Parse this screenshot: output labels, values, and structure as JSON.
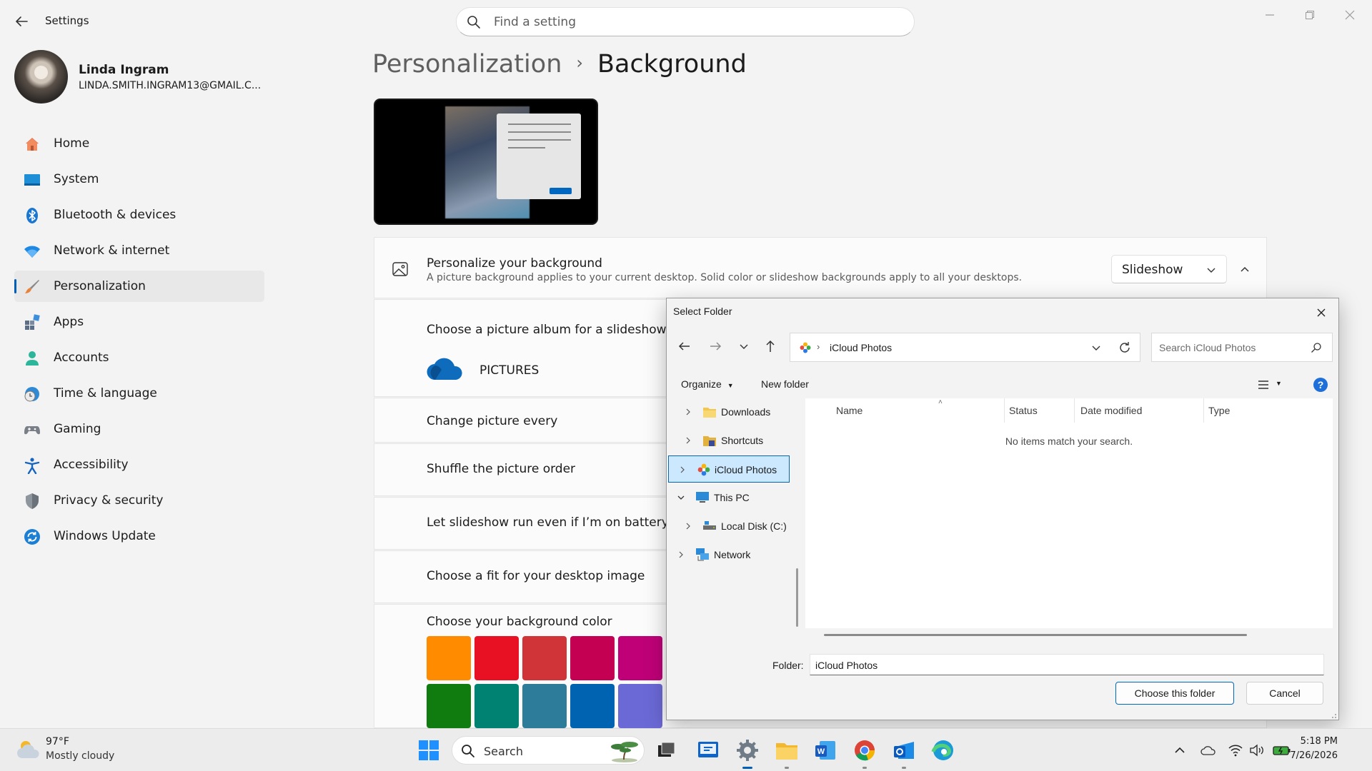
{
  "window": {
    "title": "Settings",
    "search_placeholder": "Find a setting"
  },
  "profile": {
    "name": "Linda Ingram",
    "email": "LINDA.SMITH.INGRAM13@GMAIL.C..."
  },
  "sidebar": {
    "items": [
      {
        "label": "Home",
        "icon": "home-icon"
      },
      {
        "label": "System",
        "icon": "system-icon"
      },
      {
        "label": "Bluetooth & devices",
        "icon": "bluetooth-icon"
      },
      {
        "label": "Network & internet",
        "icon": "wifi-icon"
      },
      {
        "label": "Personalization",
        "icon": "brush-icon",
        "active": true
      },
      {
        "label": "Apps",
        "icon": "apps-icon"
      },
      {
        "label": "Accounts",
        "icon": "person-icon"
      },
      {
        "label": "Time & language",
        "icon": "clock-globe-icon"
      },
      {
        "label": "Gaming",
        "icon": "gamepad-icon"
      },
      {
        "label": "Accessibility",
        "icon": "accessibility-icon"
      },
      {
        "label": "Privacy & security",
        "icon": "shield-icon"
      },
      {
        "label": "Windows Update",
        "icon": "update-icon"
      }
    ]
  },
  "breadcrumb": {
    "parent": "Personalization",
    "separator": "›",
    "current": "Background"
  },
  "background": {
    "title": "Personalize your background",
    "description": "A picture background applies to your current desktop. Solid color or slideshow backgrounds apply to all your desktops.",
    "mode": "Slideshow",
    "album_title": "Choose a picture album for a slideshow",
    "album_name": "PICTURES",
    "change_every": "Change picture every",
    "shuffle": "Shuffle the picture order",
    "battery": "Let slideshow run even if I’m on battery pow",
    "fit": "Choose a fit for your desktop image",
    "color_title": "Choose your background color",
    "swatches_row1": [
      "#ff8c00",
      "#e81123",
      "#d13438",
      "#c30052",
      "#bf0077"
    ],
    "swatches_row2": [
      "#107c10",
      "#008272",
      "#2d7d9a",
      "#0063b1",
      "#6b69d6"
    ]
  },
  "dialog": {
    "title": "Select Folder",
    "address": "iCloud Photos",
    "search_placeholder": "Search iCloud Photos",
    "organize": "Organize",
    "new_folder": "New folder",
    "tree": [
      {
        "label": "Downloads",
        "icon": "downloads-folder-icon",
        "indent": 2
      },
      {
        "label": "Shortcuts",
        "icon": "shortcuts-folder-icon",
        "indent": 2
      },
      {
        "label": "iCloud Photos",
        "icon": "icloud-photos-icon",
        "indent": 1,
        "selected": true
      },
      {
        "label": "This PC",
        "icon": "this-pc-icon",
        "indent": 1,
        "expanded": true
      },
      {
        "label": "Local Disk (C:)",
        "icon": "local-disk-icon",
        "indent": 2
      },
      {
        "label": "Network",
        "icon": "network-icon",
        "indent": 1
      }
    ],
    "columns": [
      "Name",
      "Status",
      "Date modified",
      "Type"
    ],
    "empty_message": "No items match your search.",
    "folder_label": "Folder:",
    "folder_value": "iCloud Photos",
    "choose_button": "Choose this folder",
    "cancel_button": "Cancel"
  },
  "taskbar": {
    "weather_temp": "97°F",
    "weather_desc": "Mostly cloudy",
    "search_label": "Search",
    "time": "5:18 PM",
    "date": "7/26/2026"
  }
}
